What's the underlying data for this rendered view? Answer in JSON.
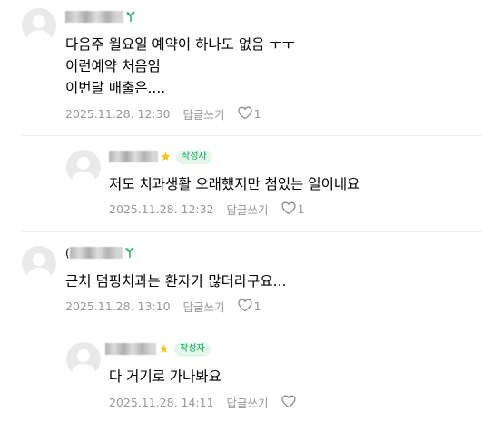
{
  "comments": [
    {
      "lines": [
        "다음주 월요일 예약이 하나도 없음 ㅜㅜ",
        "이런예약 처음임",
        "이번달 매출은...."
      ],
      "date": "2025.11.28. 12:30",
      "reply_label": "답글쓰기",
      "like_count": "1"
    },
    {
      "badge": "작성자",
      "lines": [
        "저도 치과생활 오래했지만 첨있는 일이네요"
      ],
      "date": "2025.11.28. 12:32",
      "reply_label": "답글쓰기",
      "like_count": "1"
    },
    {
      "nick_prefix": "(",
      "lines": [
        "근처 덤핑치과는 환자가 많더라구요..."
      ],
      "date": "2025.11.28. 13:10",
      "reply_label": "답글쓰기",
      "like_count": "1"
    },
    {
      "badge": "작성자",
      "lines": [
        "다 거기로 가나봐요"
      ],
      "date": "2025.11.28. 14:11",
      "reply_label": "답글쓰기",
      "like_count": ""
    }
  ],
  "colors": {
    "badge_green": "#03a94d",
    "star_yellow": "#f5c518",
    "sprout_green": "#3cb371",
    "meta_gray": "#979797"
  }
}
